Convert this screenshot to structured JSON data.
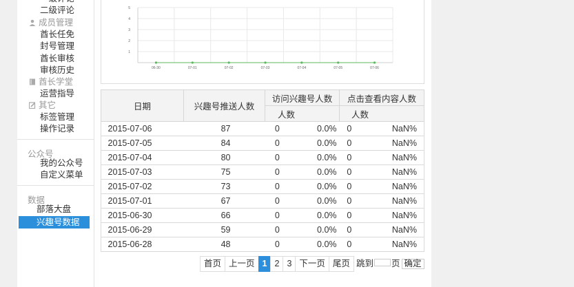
{
  "sidebar": {
    "top_item": "二级评论",
    "groups": [
      {
        "icon": "user-icon",
        "label": "成员管理",
        "items": [
          "酋长任免",
          "封号管理",
          "酋长审核",
          "审核历史"
        ]
      },
      {
        "icon": "book-icon",
        "label": "酋长学堂",
        "items": [
          "运营指导"
        ]
      },
      {
        "icon": "edit-icon",
        "label": "其它",
        "items": [
          "标签管理",
          "操作记录"
        ]
      }
    ],
    "sections": [
      {
        "title": "公众号",
        "items": [
          "我的公众号",
          "自定义菜单"
        ]
      },
      {
        "title": "数据",
        "items": [
          "部落大盘"
        ],
        "active": "兴趣号数据"
      }
    ]
  },
  "chart_data": {
    "type": "line",
    "categories": [
      "06-30",
      "07-01",
      "07-02",
      "07-03",
      "07-04",
      "07-05",
      "07-06"
    ],
    "values": [
      0,
      0,
      0,
      0,
      0,
      0,
      0
    ],
    "y_ticks": [
      "1",
      "2",
      "3",
      "4",
      "5"
    ],
    "ylim": [
      0,
      5
    ],
    "grid": true,
    "line_color": "#5cb85c"
  },
  "table": {
    "headers": {
      "date": "日期",
      "push": "兴趣号推送人数",
      "visit": "访问兴趣号人数",
      "click": "点击查看内容人数",
      "count": "人数"
    },
    "rows": [
      [
        "2015-07-06",
        "87",
        "0",
        "0.0%",
        "0",
        "NaN%"
      ],
      [
        "2015-07-05",
        "84",
        "0",
        "0.0%",
        "0",
        "NaN%"
      ],
      [
        "2015-07-04",
        "80",
        "0",
        "0.0%",
        "0",
        "NaN%"
      ],
      [
        "2015-07-03",
        "75",
        "0",
        "0.0%",
        "0",
        "NaN%"
      ],
      [
        "2015-07-02",
        "73",
        "0",
        "0.0%",
        "0",
        "NaN%"
      ],
      [
        "2015-07-01",
        "67",
        "0",
        "0.0%",
        "0",
        "NaN%"
      ],
      [
        "2015-06-30",
        "66",
        "0",
        "0.0%",
        "0",
        "NaN%"
      ],
      [
        "2015-06-29",
        "59",
        "0",
        "0.0%",
        "0",
        "NaN%"
      ],
      [
        "2015-06-28",
        "48",
        "0",
        "0.0%",
        "0",
        "NaN%"
      ]
    ]
  },
  "pagination": {
    "first": "首页",
    "prev": "上一页",
    "pages": [
      "1",
      "2",
      "3"
    ],
    "current": "1",
    "next": "下一页",
    "last": "尾页",
    "jump_prefix": "跳到",
    "jump_suffix": "页",
    "confirm": "确定"
  }
}
